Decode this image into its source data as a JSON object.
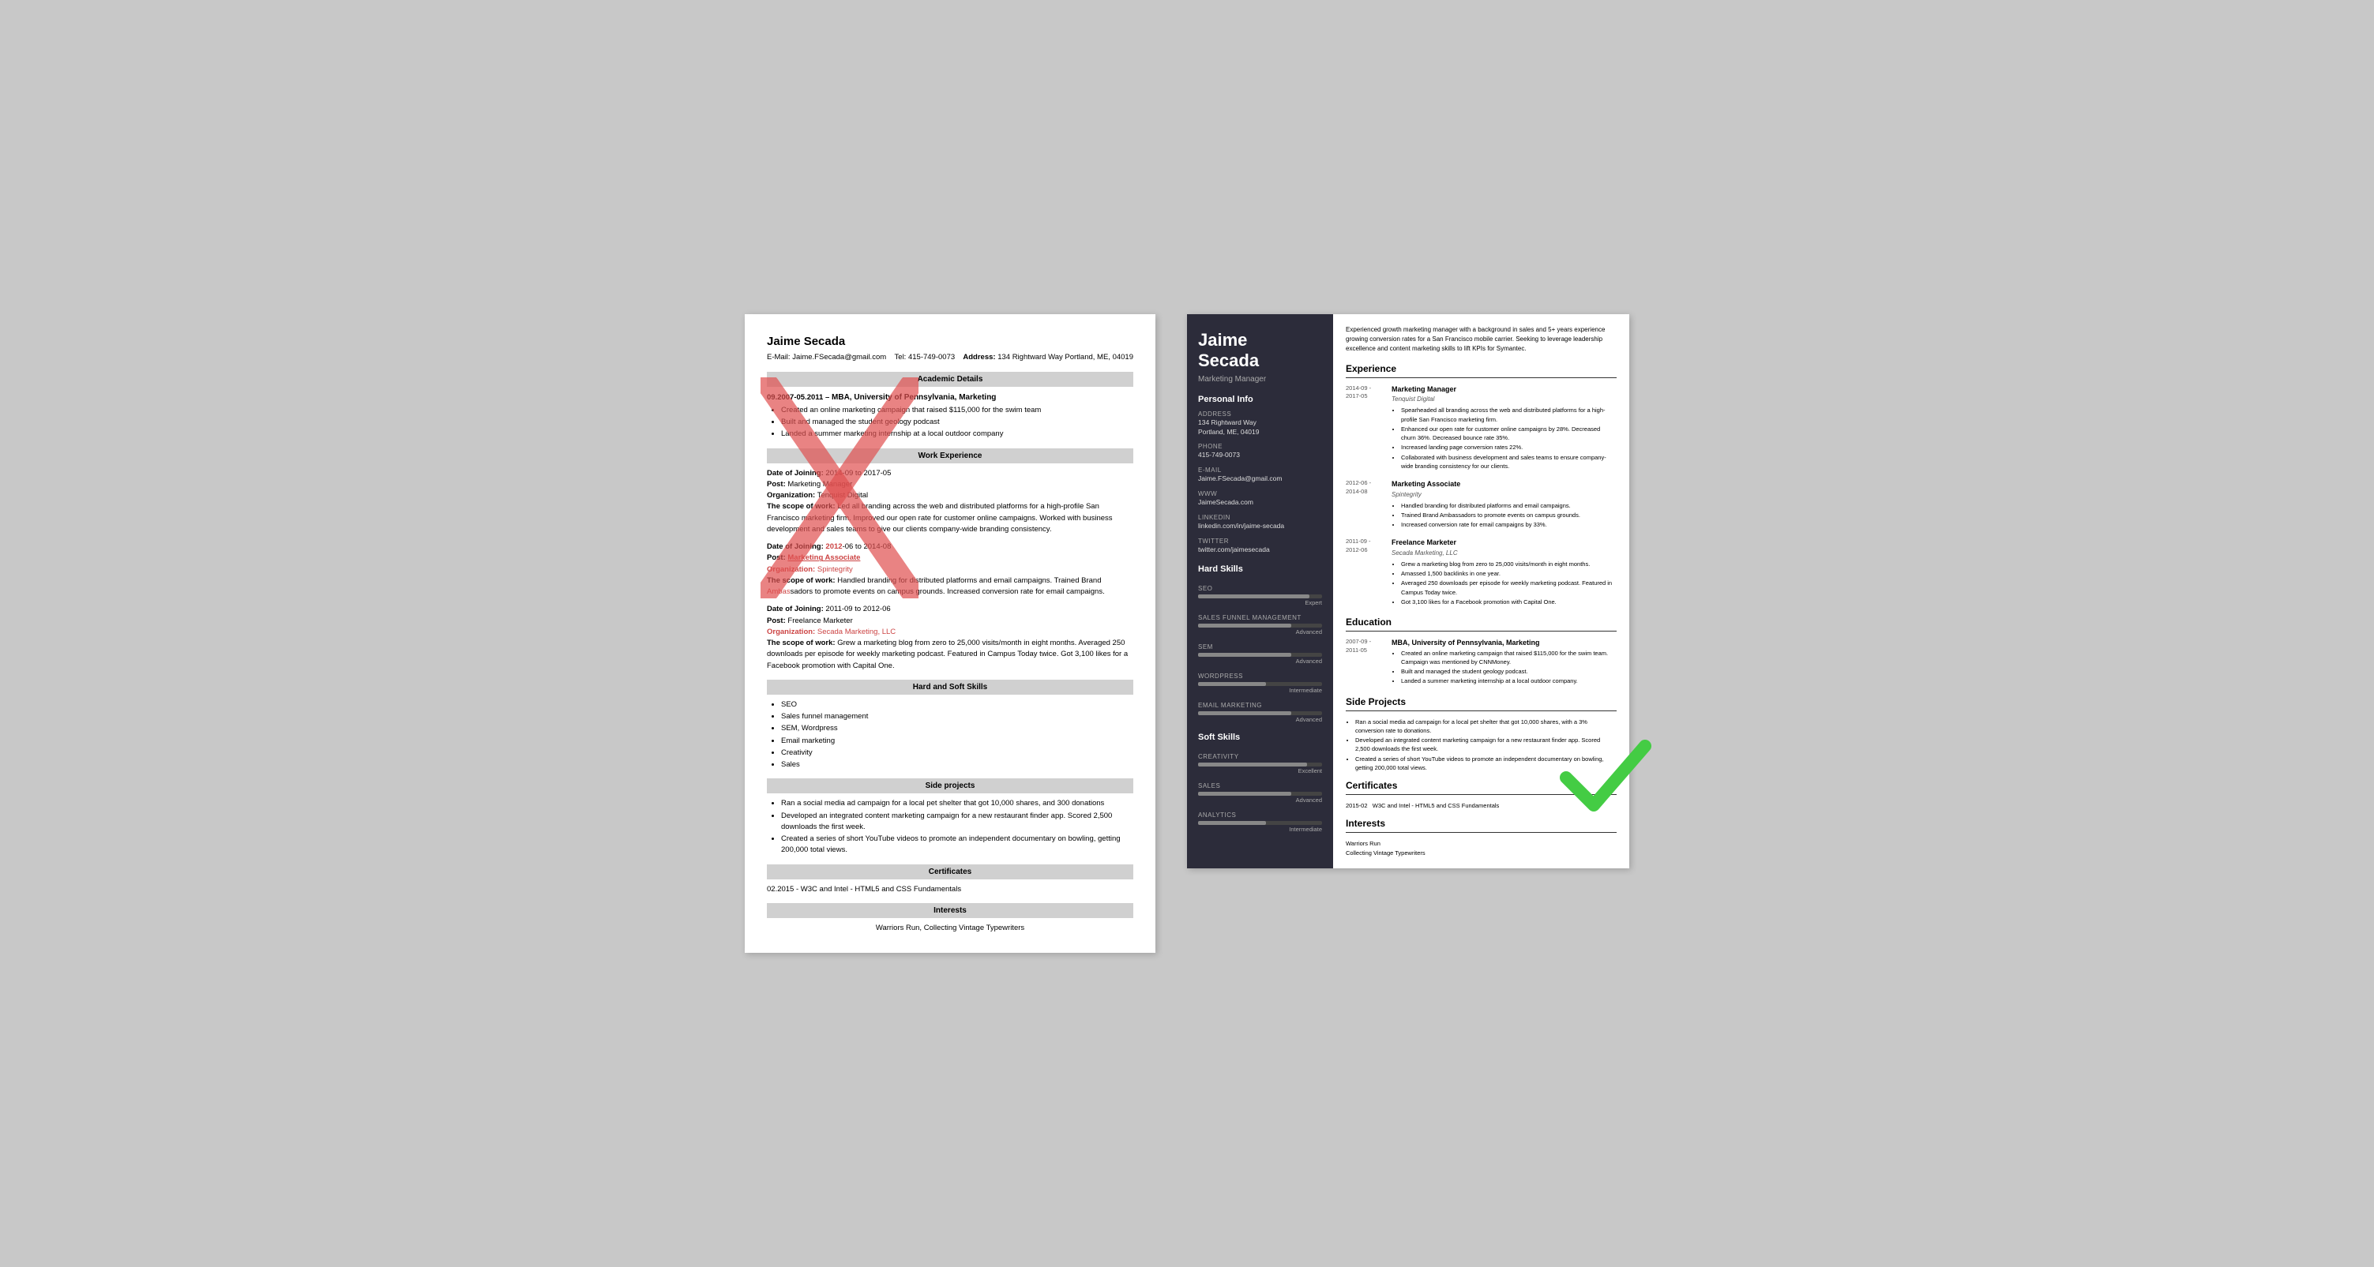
{
  "left": {
    "name": "Jaime Secada",
    "email_label": "E-Mail:",
    "email": "Jaime.FSecada@gmail.com",
    "address_label": "Address:",
    "address": "134 Rightward Way Portland, ME, 04019",
    "tel_label": "Tel:",
    "tel": "415-749-0073",
    "sections": {
      "academic": "Academic Details",
      "work": "Work Experience",
      "skills": "Hard and Soft Skills",
      "side_projects": "Side projects",
      "certificates": "Certificates",
      "interests": "Interests"
    },
    "academic": {
      "date": "09.2007-05.2011 –",
      "degree": "MBA, University of Pennsylvania, Marketing",
      "bullets": [
        "Created an online marketing campaign that raised $115,000 for the swim team",
        "Built and managed the student geology podcast",
        "Landed a summer marketing internship at a local outdoor company"
      ]
    },
    "work": [
      {
        "date_label": "Date of Joining:",
        "date": "2014-09 to 2017-05",
        "post_label": "Post:",
        "post": "Marketing Manager",
        "org_label": "Organization:",
        "org": "Tenquist Digital",
        "scope_label": "The scope of work:",
        "scope": "Led all branding across the web and distributed platforms for a high-profile San Francisco marketing firm. Improved our open rate for customer online campaigns. Worked with business development and sales teams to give our clients company-wide branding consistency."
      },
      {
        "date_label": "Date of Joining:",
        "date": "2012-06 to 2014-08",
        "post_label": "Post:",
        "post": "Marketing Associate",
        "org_label": "Organization:",
        "org": "Spintegrity",
        "scope_label": "The scope of work:",
        "scope": "Handled branding for distributed platforms and email campaigns. Trained Brand Ambassadors to promote events on campus grounds. Increased conversion rate for email campaigns."
      },
      {
        "date_label": "Date of Joining:",
        "date": "2011-09 to 2012-06",
        "post_label": "Post:",
        "post": "Freelance Marketer",
        "org_label": "Organization:",
        "org": "Secada Marketing, LLC",
        "scope_label": "The scope of work:",
        "scope": "Grew a marketing blog from zero to 25,000 visits/month in eight months. Averaged 250 downloads per episode for weekly marketing podcast. Featured in Campus Today twice. Got 3,100 likes for a Facebook promotion with Capital One."
      }
    ],
    "hard_skills": [
      "SEO",
      "Sales funnel management",
      "SEM, Wordpress",
      "Email marketing",
      "Creativity",
      "Sales"
    ],
    "side_projects": [
      "Ran a social media ad campaign for a local pet shelter that got 10,000 shares, and 300 donations",
      "Developed an integrated content marketing campaign for a new restaurant finder app. Scored 2,500 downloads the first week.",
      "Created a series of short YouTube videos to promote an independent documentary on bowling, getting 200,000 total views."
    ],
    "certificates": "02.2015 -  W3C and Intel - HTML5 and CSS Fundamentals",
    "interests": "Warriors Run, Collecting Vintage Typewriters"
  },
  "right": {
    "name_line1": "Jaime",
    "name_line2": "Secada",
    "title": "Marketing Manager",
    "summary": "Experienced growth marketing manager with a background in sales and 5+ years experience growing conversion rates for a San Francisco mobile carrier. Seeking to leverage leadership excellence and content marketing skills to lift KPIs for Symantec.",
    "personal_info_label": "Personal Info",
    "address_label": "Address",
    "address": "134 Rightward Way\nPortland, ME, 04019",
    "phone_label": "Phone",
    "phone": "415-749-0073",
    "email_label": "E-mail",
    "email": "Jaime.FSecada@gmail.com",
    "www_label": "WWW",
    "www": "JaimeSecada.com",
    "linkedin_label": "LinkedIn",
    "linkedin": "linkedin.com/in/jaime-secada",
    "twitter_label": "Twitter",
    "twitter": "twitter.com/jaimesecada",
    "hard_skills_label": "Hard Skills",
    "hard_skills": [
      {
        "name": "SEO",
        "level": "Expert",
        "pct": 90
      },
      {
        "name": "SALES FUNNEL MANAGEMENT",
        "level": "Advanced",
        "pct": 75
      },
      {
        "name": "SEM",
        "level": "Advanced",
        "pct": 75
      },
      {
        "name": "WORDPRESS",
        "level": "Intermediate",
        "pct": 55
      },
      {
        "name": "EMAIL MARKETING",
        "level": "Advanced",
        "pct": 75
      }
    ],
    "soft_skills_label": "Soft Skills",
    "soft_skills": [
      {
        "name": "CREATIVITY",
        "level": "Excellent",
        "pct": 88
      },
      {
        "name": "SALES",
        "level": "Advanced",
        "pct": 75
      },
      {
        "name": "ANALYTICS",
        "level": "Intermediate",
        "pct": 55
      }
    ],
    "experience_label": "Experience",
    "experience": [
      {
        "dates": "2014-09 -\n2017-05",
        "title": "Marketing Manager",
        "company": "Tenquist Digital",
        "bullets": [
          "Spearheaded all branding across the web and distributed platforms for a high-profile San Francisco marketing firm.",
          "Enhanced our open rate for customer online campaigns by 28%. Decreased churn 36%. Decreased bounce rate 35%.",
          "Increased landing page conversion rates 22%.",
          "Collaborated with business development and sales teams to ensure company-wide branding consistency for our clients."
        ]
      },
      {
        "dates": "2012-06 -\n2014-08",
        "title": "Marketing Associate",
        "company": "Spintegrity",
        "bullets": [
          "Handled branding for distributed platforms and email campaigns.",
          "Trained Brand Ambassadors to promote events on campus grounds.",
          "Increased conversion rate for email campaigns by 33%."
        ]
      },
      {
        "dates": "2011-09 -\n2012-06",
        "title": "Freelance Marketer",
        "company": "Secada Marketing, LLC",
        "bullets": [
          "Grew a marketing blog from zero to 25,000 visits/month in eight months.",
          "Amassed 1,500 backlinks in one year.",
          "Averaged 250 downloads per episode for weekly marketing podcast. Featured in Campus Today twice.",
          "Got 3,100 likes for a Facebook promotion with Capital One."
        ]
      }
    ],
    "education_label": "Education",
    "education": [
      {
        "dates": "2007-09 -\n2011-05",
        "degree": "MBA, University of Pennsylvania, Marketing",
        "bullets": [
          "Created an online marketing campaign that raised $115,000 for the swim team. Campaign was mentioned by CNNMoney.",
          "Built and managed the student geology podcast.",
          "Landed a summer marketing internship at a local outdoor company."
        ]
      }
    ],
    "side_projects_label": "Side Projects",
    "side_projects": [
      "Ran a social media ad campaign for a local pet shelter that got 10,000 shares, with a 3% conversion rate to donations.",
      "Developed an integrated content marketing campaign for a new restaurant finder app. Scored 2,500 downloads the first week.",
      "Created a series of short YouTube videos to promote an independent documentary on bowling, getting 200,000 total views."
    ],
    "certificates_label": "Certificates",
    "certificates": [
      {
        "date": "2015-02",
        "name": "W3C and Intel - HTML5 and CSS Fundamentals"
      }
    ],
    "interests_label": "Interests",
    "interests": [
      "Warriors Run",
      "Collecting Vintage Typewriters"
    ]
  }
}
